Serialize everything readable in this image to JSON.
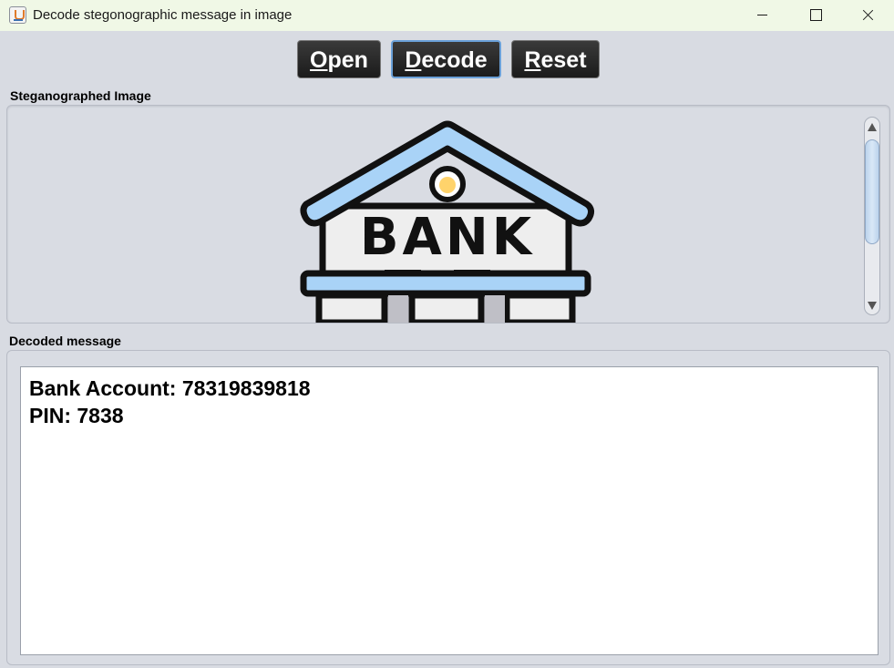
{
  "window": {
    "title": "Decode stegonographic message in image"
  },
  "toolbar": {
    "open": {
      "mnemonic": "O",
      "rest": "pen"
    },
    "decode": {
      "mnemonic": "D",
      "rest": "ecode"
    },
    "reset": {
      "mnemonic": "R",
      "rest": "eset"
    }
  },
  "image_panel": {
    "label": "Steganographed Image",
    "sign_text": "BANK"
  },
  "message_panel": {
    "label": "Decoded message",
    "lines": [
      "Bank Account: 78319839818",
      "PIN: 7838"
    ]
  },
  "colors": {
    "roof_fill": "#a9d3f7",
    "sign_fill": "#eeeeee",
    "window_fill": "#ffd36b",
    "outline": "#111111",
    "button_bg": "#222222"
  }
}
